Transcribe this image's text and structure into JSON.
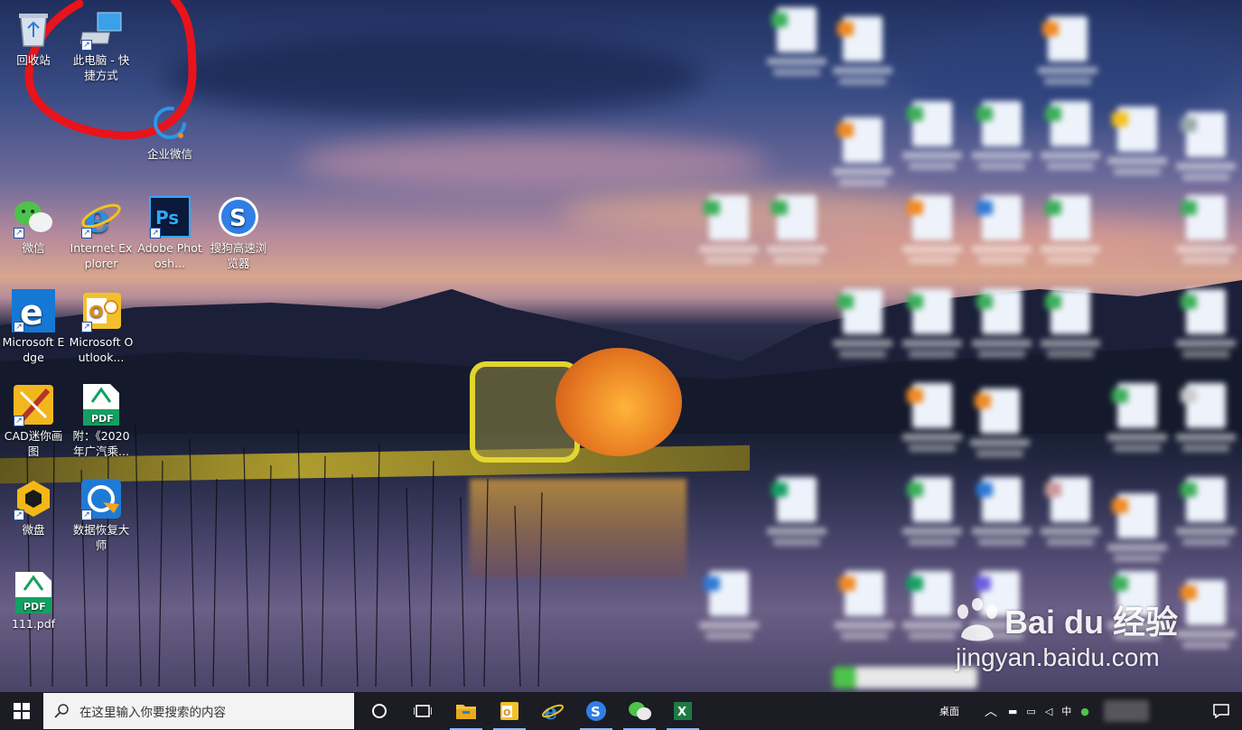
{
  "desktop": {
    "icons": [
      {
        "label": "回收站",
        "icon": "recycle-bin-icon"
      },
      {
        "label": "此电脑 - 快捷方式",
        "icon": "this-pc-icon"
      },
      {
        "label": "企业微信",
        "icon": "wecom-icon"
      },
      {
        "label": "微信",
        "icon": "wechat-icon"
      },
      {
        "label": "Internet Explorer",
        "icon": "internet-explorer-icon"
      },
      {
        "label": "Adobe Photosh...",
        "icon": "photoshop-icon"
      },
      {
        "label": "搜狗高速浏览器",
        "icon": "sogou-browser-icon"
      },
      {
        "label": "Microsoft Edge",
        "icon": "edge-icon"
      },
      {
        "label": "Microsoft Outlook...",
        "icon": "outlook-icon"
      },
      {
        "label": "CAD迷你画图",
        "icon": "cad-icon"
      },
      {
        "label": "附：《2020年广汽乘...",
        "icon": "pdf-icon"
      },
      {
        "label": "微盘",
        "icon": "weipan-icon"
      },
      {
        "label": "数据恢复大师",
        "icon": "data-recovery-icon"
      },
      {
        "label": "111.pdf",
        "icon": "pdf-icon"
      }
    ],
    "annotation_color": "#e8131b"
  },
  "taskbar": {
    "search_placeholder": "在这里输入你要搜索的内容",
    "tray_label": "桌面",
    "ime_label": "中"
  },
  "watermark": {
    "brand": "Bai du 经验",
    "url": "jingyan.baidu.com"
  }
}
